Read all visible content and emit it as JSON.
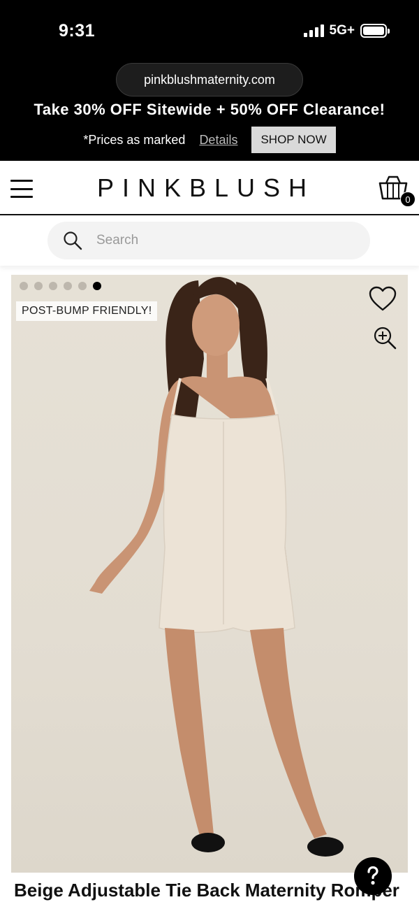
{
  "status_bar": {
    "time": "9:31",
    "network": "5G+",
    "signal_bars": 4,
    "battery_level": 1.0
  },
  "browser": {
    "url": "pinkblushmaternity.com"
  },
  "promo": {
    "headline": "Take 30% OFF Sitewide + 50% OFF Clearance!",
    "note": "*Prices as marked",
    "details_link": "Details",
    "shop_now": "SHOP NOW"
  },
  "header": {
    "logo": "PINKBLUSH",
    "cart_count": "0",
    "menu_icon": "hamburger-icon",
    "cart_icon": "shopping-bag-icon"
  },
  "search": {
    "placeholder": "Search",
    "icon": "search-icon"
  },
  "product": {
    "badge": "POST-BUMP FRIENDLY!",
    "image_count": 6,
    "active_image": 6,
    "title": "Beige Adjustable Tie Back Maternity Romper",
    "favorite_icon": "heart-icon",
    "zoom_icon": "zoom-in-icon"
  },
  "help": {
    "icon": "question-icon"
  },
  "colors": {
    "banner_bg": "#000000",
    "image_bg": "#e4dfd4",
    "romper": "#ece3d6"
  }
}
